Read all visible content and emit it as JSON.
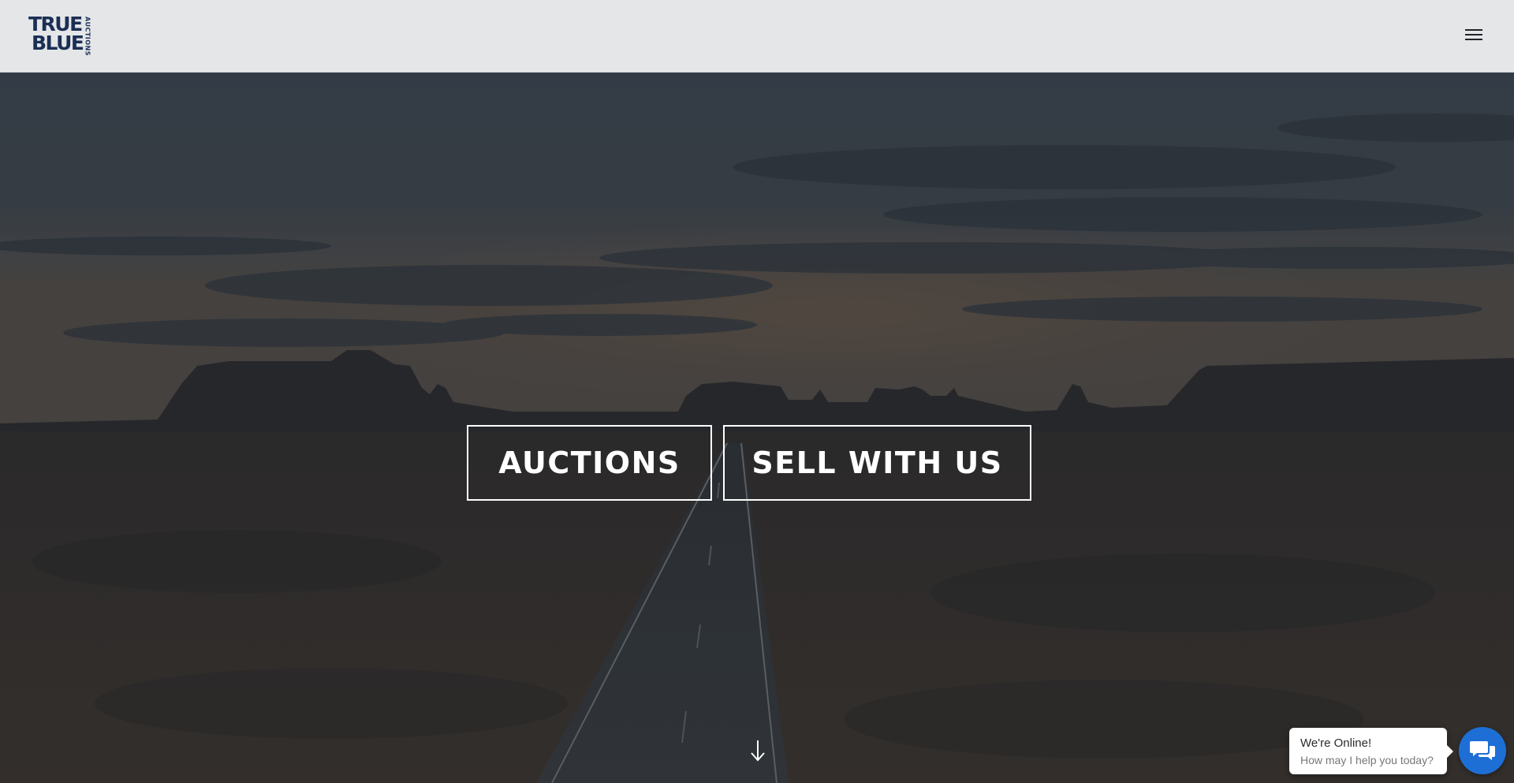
{
  "header": {
    "logo": {
      "line1": "TRUE",
      "line2": "BLUE",
      "side_text": "AUCTIONS",
      "color": "#1b2f55"
    },
    "background_color": "#e4e6e8",
    "menu_icon": "hamburger-menu-icon"
  },
  "hero": {
    "buttons": {
      "auctions_label": "AUCTIONS",
      "sell_label": "SELL WITH US"
    },
    "scroll_icon": "arrow-down-icon",
    "overlay_color": "#2f3339"
  },
  "chat": {
    "title": "We're Online!",
    "subtitle": "How may I help you today?",
    "launcher_icon": "chat-bubbles-icon",
    "launcher_color": "#1d6fd6"
  }
}
